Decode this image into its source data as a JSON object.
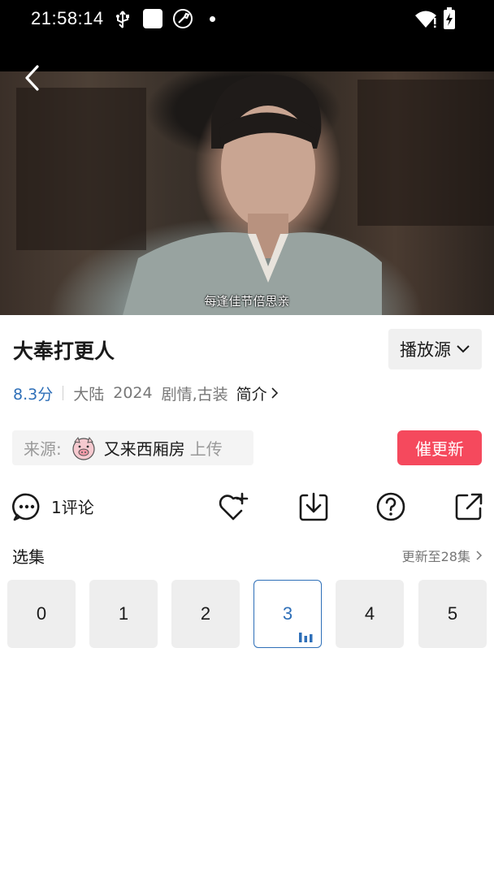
{
  "status_bar": {
    "time": "21:58:14",
    "icons": [
      "usb-icon",
      "square-notification-icon",
      "wrench-icon",
      "dot-icon",
      "wifi-icon",
      "battery-charging-icon"
    ]
  },
  "player": {
    "subtitle": "每逢佳节倍思亲",
    "back_icon": "chevron-left-icon"
  },
  "show": {
    "title": "大奉打更人",
    "source_button": "播放源",
    "score": "8.3分",
    "region": "大陆",
    "year": "2024",
    "genres": "剧情,古装",
    "intro_label": "简介"
  },
  "uploader": {
    "prefix": "来源:",
    "name": "又来西厢房",
    "suffix": "上传",
    "urge_button": "催更新"
  },
  "actions": {
    "comment_label": "1评论",
    "icons": [
      "comment-icon",
      "favorite-add-icon",
      "download-icon",
      "help-icon",
      "share-icon"
    ]
  },
  "episodes": {
    "title": "选集",
    "more_label": "更新至28集",
    "items": [
      "0",
      "1",
      "2",
      "3",
      "4",
      "5"
    ],
    "selected": "3"
  },
  "colors": {
    "accent_blue": "#2e6fb8",
    "urge_red": "#f5495d",
    "chip_bg": "#eeeeee"
  }
}
